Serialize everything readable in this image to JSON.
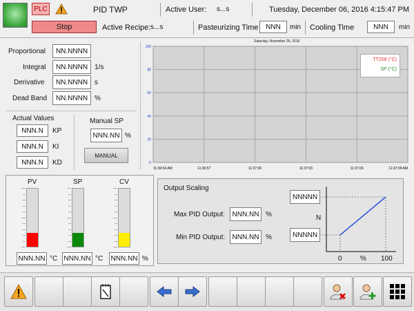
{
  "header": {
    "plc_label": "PLC",
    "title": "PID TWP",
    "active_user_label": "Active User:",
    "active_user_value": "s...s",
    "datetime": "Tuesday, December 06, 2016 4:15:47 PM",
    "stop_label": "Stop",
    "active_recipe_label": "Active Recipe:",
    "active_recipe_value": "s...s",
    "past_time_label": "Pasteurizing Time",
    "past_time_value": "NNN",
    "past_time_unit": "min",
    "cool_time_label": "Cooling Time",
    "cool_time_value": "NNN",
    "cool_time_unit": "min"
  },
  "tuning": {
    "proportional_label": "Proportional",
    "proportional_value": "NN.NNNN",
    "integral_label": "Integral",
    "integral_value": "NN.NNNN",
    "integral_unit": "1/s",
    "derivative_label": "Derivative",
    "derivative_value": "NN.NNNN",
    "derivative_unit": "s",
    "deadband_label": "Dead Band",
    "deadband_value": "NN.NNNN",
    "deadband_unit": "%"
  },
  "actual_values": {
    "title": "Actual Values",
    "kp_value": "NNN.N",
    "kp_label": "KP",
    "ki_value": "NNN.N",
    "ki_label": "KI",
    "kd_value": "NNN.N",
    "kd_label": "KD"
  },
  "manual": {
    "title": "Manual SP",
    "sp_value": "NNN.NN",
    "sp_unit": "%",
    "button_label": "MANUAL"
  },
  "trend": {
    "title": "Saturday, November 26, 2016",
    "legend_tt": "TT208 (°C)",
    "legend_sp": "SP (°C)",
    "color_tt": "#e0303a",
    "color_sp": "#2e8b2e"
  },
  "chart_data": {
    "type": "line",
    "title": "Saturday, November 26, 2016",
    "ylim": [
      0,
      100
    ],
    "y_ticks": [
      "100",
      "80",
      "60",
      "40",
      "20",
      "0"
    ],
    "x_ticks": [
      "11:36:54 AM",
      "11:36:57",
      "11:37:00",
      "11:37:03",
      "11:37:06",
      "11:37:09 AM"
    ],
    "series": [
      {
        "name": "TT208 (°C)",
        "values": []
      },
      {
        "name": "SP (°C)",
        "values": []
      }
    ],
    "grid": true,
    "legend": "top-right"
  },
  "gauges": {
    "pv_label": "PV",
    "pv_level": 0.24,
    "pv_color": "#ff0000",
    "pv_value": "NNN.NN",
    "pv_unit": "°C",
    "sp_label": "SP",
    "sp_level": 0.24,
    "sp_color": "#0a8a0a",
    "sp_value": "NNN.NN",
    "sp_unit": "°C",
    "cv_label": "CV",
    "cv_level": 0.24,
    "cv_color": "#ffee00",
    "cv_value": "NNN.NN",
    "cv_unit": "%"
  },
  "output_scaling": {
    "title": "Output Scaling",
    "max_label": "Max PID Output:",
    "max_value": "NNN.NN",
    "max_unit": "%",
    "min_label": "Min PID Output:",
    "min_value": "NNN.NN",
    "min_unit": "%",
    "top_value": "NNNNN",
    "bottom_value": "NNNNN",
    "n_label": "N",
    "x0": "0",
    "xpct": "%",
    "x100": "100"
  },
  "toolbar": {
    "icons": [
      "alarm-icon",
      "",
      "",
      "notepad-icon",
      "",
      "arrow-left-icon",
      "arrow-right-icon",
      "",
      "",
      "",
      "",
      "user-remove-icon",
      "user-add-icon",
      "menu-grid-icon"
    ]
  }
}
